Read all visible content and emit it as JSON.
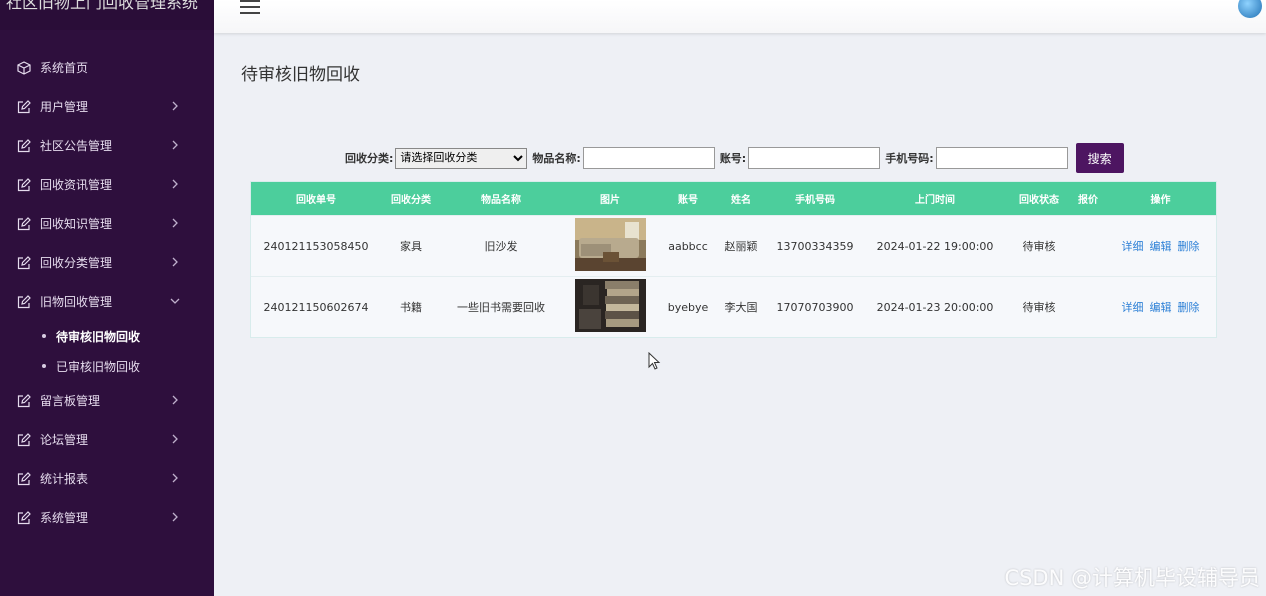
{
  "app": {
    "title": "社区旧物上门回收管理系统"
  },
  "sidebar": {
    "items": [
      {
        "label": "系统首页",
        "icon": "cube-icon"
      },
      {
        "label": "用户管理",
        "icon": "edit-icon"
      },
      {
        "label": "社区公告管理",
        "icon": "edit-icon"
      },
      {
        "label": "回收资讯管理",
        "icon": "edit-icon"
      },
      {
        "label": "回收知识管理",
        "icon": "edit-icon"
      },
      {
        "label": "回收分类管理",
        "icon": "edit-icon"
      },
      {
        "label": "旧物回收管理",
        "icon": "edit-icon"
      },
      {
        "label": "留言板管理",
        "icon": "edit-icon"
      },
      {
        "label": "论坛管理",
        "icon": "edit-icon"
      },
      {
        "label": "统计报表",
        "icon": "edit-icon"
      },
      {
        "label": "系统管理",
        "icon": "edit-icon"
      }
    ],
    "subitems": [
      {
        "label": "待审核旧物回收"
      },
      {
        "label": "已审核旧物回收"
      }
    ]
  },
  "main": {
    "title": "待审核旧物回收",
    "search": {
      "category_label": "回收分类:",
      "category_value": "请选择回收分类",
      "name_label": "物品名称:",
      "account_label": "账号:",
      "phone_label": "手机号码:",
      "button": "搜索"
    },
    "table": {
      "headers": [
        "回收单号",
        "回收分类",
        "物品名称",
        "图片",
        "账号",
        "姓名",
        "手机号码",
        "上门时间",
        "回收状态",
        "报价",
        "操作"
      ],
      "rows": [
        {
          "id": "240121153058450",
          "category": "家具",
          "name": "旧沙发",
          "account": "aabbcc",
          "person": "赵丽颖",
          "phone": "13700334359",
          "time": "2024-01-22 19:00:00",
          "status": "待审核",
          "quote": ""
        },
        {
          "id": "240121150602674",
          "category": "书籍",
          "name": "一些旧书需要回收",
          "account": "byebye",
          "person": "李大国",
          "phone": "17070703900",
          "time": "2024-01-23 20:00:00",
          "status": "待审核",
          "quote": ""
        }
      ],
      "actions": {
        "detail": "详细",
        "edit": "编辑",
        "delete": "删除"
      }
    }
  },
  "watermark": "CSDN @计算机毕设辅导员",
  "colors": {
    "sidebar": "#2e0f3d",
    "header_row": "#4cce9c",
    "search_button": "#4d1561",
    "link": "#2b7fd6"
  }
}
